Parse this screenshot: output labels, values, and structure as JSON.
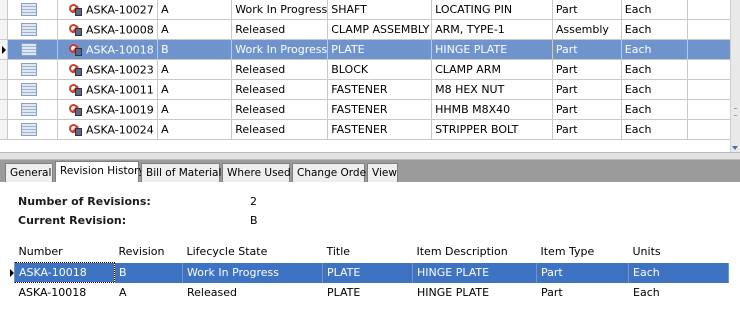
{
  "top_grid": {
    "rows": [
      {
        "number": "ASKA-10027",
        "revision": "A",
        "lifecycle": "Work In Progress",
        "title": "SHAFT",
        "description": "LOCATING PIN",
        "item_type": "Part",
        "units": "Each",
        "selected": false
      },
      {
        "number": "ASKA-10008",
        "revision": "A",
        "lifecycle": "Released",
        "title": "CLAMP ASSEMBLY",
        "description": "ARM, TYPE-1",
        "item_type": "Assembly",
        "units": "Each",
        "selected": false
      },
      {
        "number": "ASKA-10018",
        "revision": "B",
        "lifecycle": "Work In Progress",
        "title": "PLATE",
        "description": "HINGE PLATE",
        "item_type": "Part",
        "units": "Each",
        "selected": true
      },
      {
        "number": "ASKA-10023",
        "revision": "A",
        "lifecycle": "Released",
        "title": "BLOCK",
        "description": "CLAMP ARM",
        "item_type": "Part",
        "units": "Each",
        "selected": false
      },
      {
        "number": "ASKA-10011",
        "revision": "A",
        "lifecycle": "Released",
        "title": "FASTENER",
        "description": "M8 HEX NUT",
        "item_type": "Part",
        "units": "Each",
        "selected": false
      },
      {
        "number": "ASKA-10019",
        "revision": "A",
        "lifecycle": "Released",
        "title": "FASTENER",
        "description": "HHMB M8X40",
        "item_type": "Part",
        "units": "Each",
        "selected": false
      },
      {
        "number": "ASKA-10024",
        "revision": "A",
        "lifecycle": "Released",
        "title": "FASTENER",
        "description": "STRIPPER BOLT",
        "item_type": "Part",
        "units": "Each",
        "selected": false
      }
    ]
  },
  "tabs": [
    {
      "label": "General",
      "active": false
    },
    {
      "label": "Revision History",
      "active": true
    },
    {
      "label": "Bill of Materials",
      "active": false
    },
    {
      "label": "Where Used",
      "active": false
    },
    {
      "label": "Change Order",
      "active": false
    },
    {
      "label": "View",
      "active": false
    }
  ],
  "revision_summary": {
    "count_label": "Number of Revisions:",
    "count_value": "2",
    "current_label": "Current Revision:",
    "current_value": "B"
  },
  "history_grid": {
    "headers": {
      "number": "Number",
      "revision": "Revision",
      "lifecycle": "Lifecycle State",
      "title": "Title",
      "description": "Item Description",
      "item_type": "Item Type",
      "units": "Units"
    },
    "rows": [
      {
        "number": "ASKA-10018",
        "revision": "B",
        "lifecycle": "Work In Progress",
        "title": "PLATE",
        "description": "HINGE PLATE",
        "item_type": "Part",
        "units": "Each",
        "selected": true
      },
      {
        "number": "ASKA-10018",
        "revision": "A",
        "lifecycle": "Released",
        "title": "PLATE",
        "description": "HINGE PLATE",
        "item_type": "Part",
        "units": "Each",
        "selected": false
      }
    ]
  },
  "colors": {
    "selection_top": "#6f93cc",
    "selection_bottom": "#3e72c2",
    "tab_strip": "#9b9b9b"
  }
}
